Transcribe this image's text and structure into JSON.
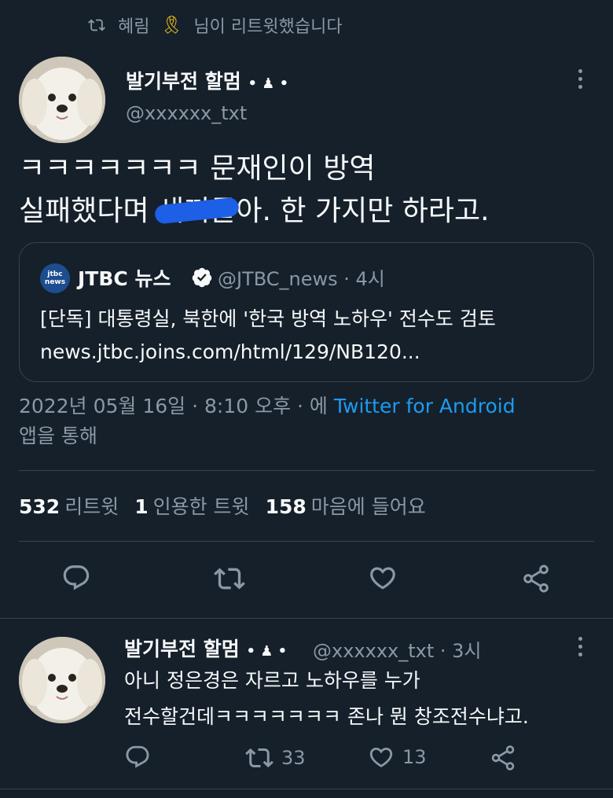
{
  "retweet_context": {
    "user": "혜림",
    "suffix": "님이 리트윗했습니다"
  },
  "tweet": {
    "author": {
      "name": "발기부전 할멈",
      "name_badges": "• ♟ •",
      "handle": "@xxxxxx_txt"
    },
    "text_line1": "ㅋㅋㅋㅋㅋㅋㅋ 문재인이 방역",
    "text_line2_prefix": "실패했다며 ",
    "text_line2_redacted": "새끼들",
    "text_line2_suffix": "아. 한 가지만 하라고.",
    "quote": {
      "logo_line1": "jtbc",
      "logo_line2": "news",
      "name": "JTBC 뉴스",
      "meta": "@JTBC_news · 4시",
      "line1": "[단독] 대통령실, 북한에 '한국 방역 노하우' 전수도 검토",
      "line2": "news.jtbc.joins.com/html/129/NB120..."
    },
    "timestamp": "2022년 05월 16일 · 8:10 오후 · 에 ",
    "source": "Twitter for Android",
    "timestamp_suffix": "앱을 통해",
    "stats": [
      {
        "value": "532",
        "label": "리트윗"
      },
      {
        "value": "1",
        "label": "인용한 트윗"
      },
      {
        "value": "158",
        "label": "마음에 들어요"
      }
    ]
  },
  "reply": {
    "author": {
      "name": "발기부전 할멈",
      "name_badges": "• ♟ •",
      "meta": "@xxxxxx_txt · 3시"
    },
    "line1": "아니 정은경은 자르고 노하우를 누가",
    "line2": "전수할건데ㅋㅋㅋㅋㅋㅋㅋ 존나 뭔 창조전수냐고.",
    "retweets": "33",
    "likes": "13"
  },
  "colors": {
    "background": "#15202b",
    "text": "#f7f9f9",
    "muted": "#8b98a5",
    "link": "#1d9bf0",
    "divider": "#38444d"
  },
  "icons": [
    "retweet-icon",
    "ribbon-icon",
    "more-icon",
    "verified-icon",
    "reply-icon",
    "like-icon",
    "share-icon"
  ]
}
